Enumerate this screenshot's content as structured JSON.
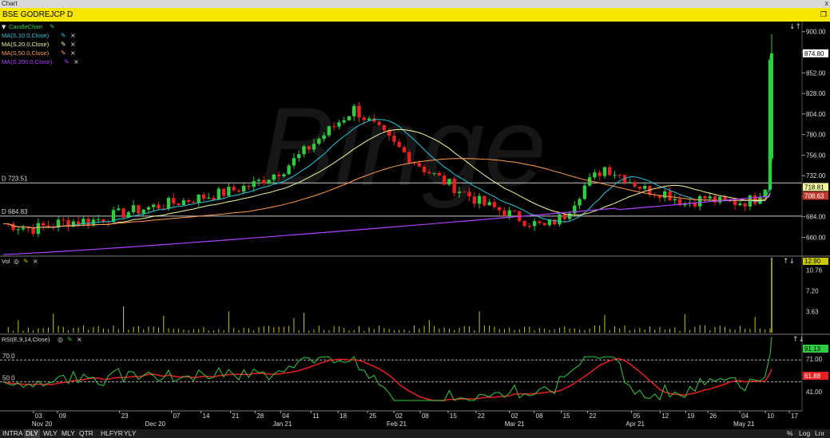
{
  "window": {
    "title": "Chart",
    "close_label": "x"
  },
  "header": {
    "symbol_title": "BSE GODREJCP D",
    "restore_label": "❐"
  },
  "watermark": "Binge",
  "price_panel": {
    "legend": [
      {
        "label": "CandleChart",
        "color": "#2ecc40",
        "icons": [
          "pencil-icon"
        ]
      },
      {
        "label": "MA(S,10.0,Close)",
        "color": "#26c6da",
        "icons": [
          "pencil-icon",
          "close-icon"
        ]
      },
      {
        "label": "MA(S,20.0,Close)",
        "color": "#f5f5a0",
        "icons": [
          "pencil-icon",
          "close-icon"
        ]
      },
      {
        "label": "MA(S,50.0,Close)",
        "color": "#ff9a50",
        "icons": [
          "pencil-icon",
          "close-icon"
        ]
      },
      {
        "label": "MA(S,200.0,Close)",
        "color": "#b040ff",
        "icons": [
          "pencil-icon",
          "close-icon"
        ]
      }
    ],
    "hlines": [
      {
        "label": "D 723.51",
        "value": 723.51
      },
      {
        "label": "D 684.83",
        "value": 684.83
      }
    ],
    "yaxis": {
      "ticks": [
        "900.00",
        "876.00",
        "852.00",
        "828.00",
        "804.00",
        "780.00",
        "756.00",
        "732.00",
        "708.00",
        "684.00",
        "660.00"
      ],
      "min": 640,
      "max": 910
    },
    "price_tags": [
      {
        "text": "874.80",
        "value": 874.8,
        "bg": "#ffffff",
        "fg": "#000000"
      },
      {
        "text": "718.81",
        "value": 718.81,
        "bg": "#f5f5a0",
        "fg": "#000000"
      },
      {
        "text": "708.63",
        "value": 708.63,
        "bg": "#c0392b",
        "fg": "#ffffff"
      }
    ],
    "corner_icons": "↓↑"
  },
  "volume_panel": {
    "label": "Vol",
    "icons": [
      "eye-icon",
      "pencil-icon",
      "close-icon"
    ],
    "yaxis": {
      "ticks": [
        "10.76",
        "7.20",
        "3.63"
      ],
      "max": 12.9
    },
    "last_tag": "12.90",
    "corner_icons": "↑↓"
  },
  "rsi_panel": {
    "label": "RSI(E,9,14,Close)",
    "icons": [
      "eye-icon",
      "pencil-icon",
      "close-icon"
    ],
    "yaxis": {
      "ticks": [
        "71.00",
        "41.00"
      ],
      "min": 25,
      "max": 92
    },
    "levels": [
      {
        "label": "70.0",
        "value": 70
      },
      {
        "label": "50.0",
        "value": 50
      }
    ],
    "tags": [
      {
        "text": "91.13",
        "bg": "#2ecc40",
        "fg": "#000000"
      },
      {
        "text": "61.88",
        "bg": "#e82020",
        "fg": "#ffffff"
      }
    ],
    "corner_icons": "↑↓"
  },
  "xaxis": {
    "days": [
      {
        "label": "03",
        "pos": 0.04
      },
      {
        "label": "09",
        "pos": 0.07
      },
      {
        "label": "23",
        "pos": 0.148
      },
      {
        "label": "07",
        "pos": 0.213
      },
      {
        "label": "14",
        "pos": 0.25
      },
      {
        "label": "21",
        "pos": 0.287
      },
      {
        "label": "28",
        "pos": 0.318
      },
      {
        "label": "04",
        "pos": 0.35
      },
      {
        "label": "11",
        "pos": 0.388
      },
      {
        "label": "18",
        "pos": 0.422
      },
      {
        "label": "25",
        "pos": 0.459
      },
      {
        "label": "02",
        "pos": 0.492
      },
      {
        "label": "08",
        "pos": 0.525
      },
      {
        "label": "15",
        "pos": 0.56
      },
      {
        "label": "22",
        "pos": 0.595
      },
      {
        "label": "02",
        "pos": 0.637
      },
      {
        "label": "08",
        "pos": 0.668
      },
      {
        "label": "15",
        "pos": 0.702
      },
      {
        "label": "22",
        "pos": 0.735
      },
      {
        "label": "05",
        "pos": 0.79
      },
      {
        "label": "12",
        "pos": 0.826
      },
      {
        "label": "19",
        "pos": 0.858
      },
      {
        "label": "26",
        "pos": 0.886
      },
      {
        "label": "04",
        "pos": 0.926
      },
      {
        "label": "10",
        "pos": 0.958
      },
      {
        "label": "17",
        "pos": 0.988
      }
    ],
    "months": [
      {
        "label": "Nov 20",
        "pos": 0.04
      },
      {
        "label": "Dec 20",
        "pos": 0.182
      },
      {
        "label": "Jan 21",
        "pos": 0.342
      },
      {
        "label": "Feb 21",
        "pos": 0.485
      },
      {
        "label": "Mar 21",
        "pos": 0.633
      },
      {
        "label": "Apr 21",
        "pos": 0.785
      },
      {
        "label": "May 21",
        "pos": 0.92
      }
    ]
  },
  "periods": [
    "INTRA",
    "DLY",
    "WLY",
    "MLY",
    "QTR",
    "HLFYR",
    "YLY"
  ],
  "active_period": "DLY",
  "bottom_right": [
    "%",
    "Log",
    "Lnr"
  ],
  "colors": {
    "up": "#2ecc40",
    "down": "#e82020",
    "volume": "#c8c800",
    "rsi": "#2ecc40",
    "rsi_signal": "#e82020",
    "grid_line": "#c8c8c8"
  }
}
